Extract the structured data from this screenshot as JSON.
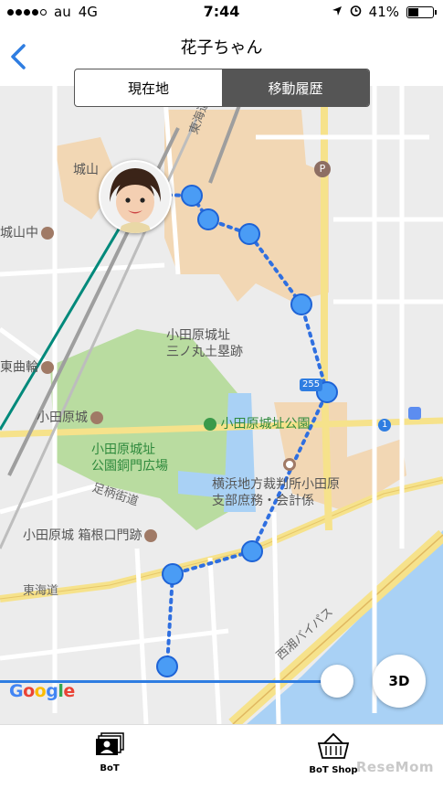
{
  "status_bar": {
    "carrier": "au",
    "network": "4G",
    "time": "7:44",
    "battery": "41%",
    "battery_level": 0.41,
    "signal_bars": 4
  },
  "nav": {
    "title": "花子ちゃん",
    "back_icon": "chevron-left-icon"
  },
  "segments": {
    "current_location": "現在地",
    "history": "移動履歴",
    "selected": "移動履歴"
  },
  "map": {
    "labels": {
      "castle_top": "城山",
      "shiroyama_middle": "城山中",
      "higashi_kuruwa": "東曲輪",
      "odawara_castle": "小田原城",
      "sannomaru": "小田原城址\n三ノ丸土塁跡",
      "castle_park": "小田原城址公園",
      "park_plaza": "小田原城址\n公園銅門広場",
      "ashigara": "足柄街道",
      "hakone_gate": "小田原城 箱根口門跡",
      "court": "横浜地方裁判所小田原\n支部庶務・会計係",
      "tokaido": "東海道",
      "tokaido_honsen": "東海道本線",
      "seisho_bypass": "西湘バイパス",
      "route_255": "255",
      "route_1": "1",
      "parking": "P"
    }
  },
  "controls": {
    "google_logo": "Google",
    "btn_3d": "3D",
    "timeline_position": 0.76
  },
  "tabs": [
    {
      "label": "BoT",
      "icon": "photo-cards-icon"
    },
    {
      "label": "BoT Shop",
      "icon": "shopping-basket-icon"
    }
  ],
  "watermark": "ReseMom",
  "colors": {
    "accent": "#2f7de1",
    "track_point": "#4a9cf5",
    "park_green": "#b9dca0",
    "water": "#a9d1f5",
    "built_area": "#f2d7b4"
  }
}
